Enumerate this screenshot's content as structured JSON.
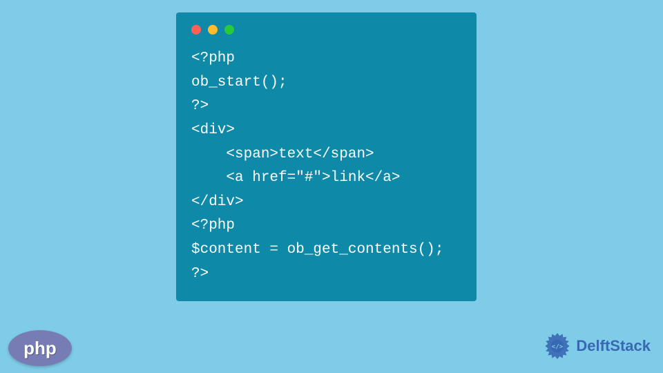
{
  "code": {
    "lines": [
      "<?php",
      "ob_start();",
      "?>",
      "<div>",
      "    <span>text</span>",
      "    <a href=\"#\">link</a>",
      "</div>",
      "<?php",
      "$content = ob_get_contents();",
      "?>"
    ]
  },
  "logos": {
    "php_label": "php",
    "delft_label": "DelftStack"
  }
}
